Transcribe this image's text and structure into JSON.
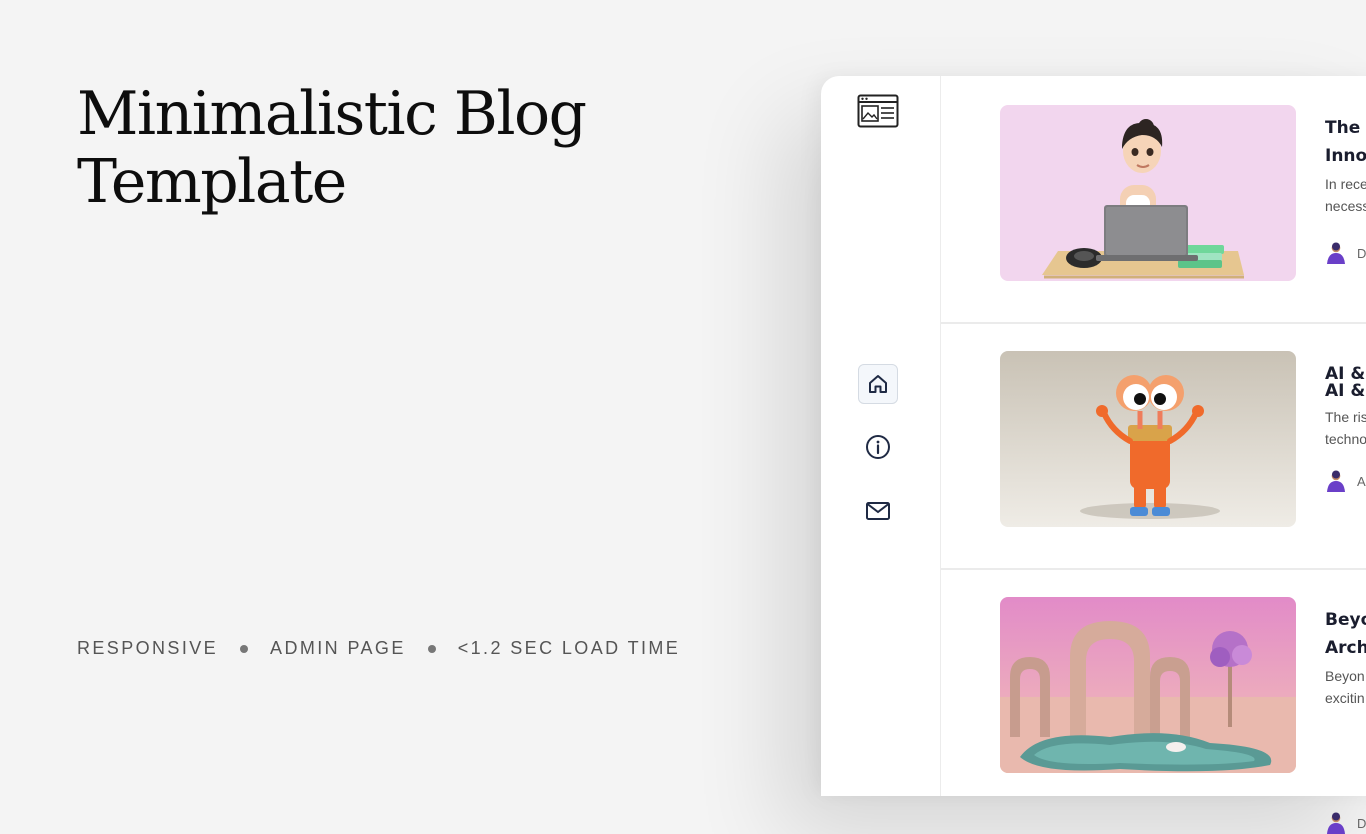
{
  "hero": {
    "title_line1": "Minimalistic Blog",
    "title_line2": "Template"
  },
  "features": [
    "RESPONSIVE",
    "ADMIN PAGE",
    "<1.2 SEC LOAD TIME"
  ],
  "sidebar": {
    "logo_icon": "blog-layout-icon",
    "items": [
      {
        "name": "home",
        "icon": "home-icon",
        "active": true
      },
      {
        "name": "about",
        "icon": "info-icon",
        "active": false
      },
      {
        "name": "contact",
        "icon": "mail-icon",
        "active": false
      }
    ]
  },
  "posts": [
    {
      "title_line1": "The I",
      "title_line2": "Innov",
      "excerpt_line1": "In rece",
      "excerpt_line2": "necess",
      "author": "D",
      "thumbnail": "woman-at-laptop-illustration"
    },
    {
      "title_line1": "AI & I",
      "title_line2": "",
      "excerpt_line1": "The ris",
      "excerpt_line2": "techno",
      "author": "A",
      "thumbnail": "orange-robot-character-illustration"
    },
    {
      "title_line1": "Beyo",
      "title_line2": "Arch",
      "excerpt_line1": "Beyon",
      "excerpt_line2": "excitin",
      "author": "D",
      "thumbnail": "arches-pool-scene-illustration"
    }
  ],
  "colors": {
    "page_bg": "#f4f4f4",
    "title": "#0d0d0d",
    "post_title": "#1a1d2e",
    "avatar_accent": "#6a3fc8"
  }
}
